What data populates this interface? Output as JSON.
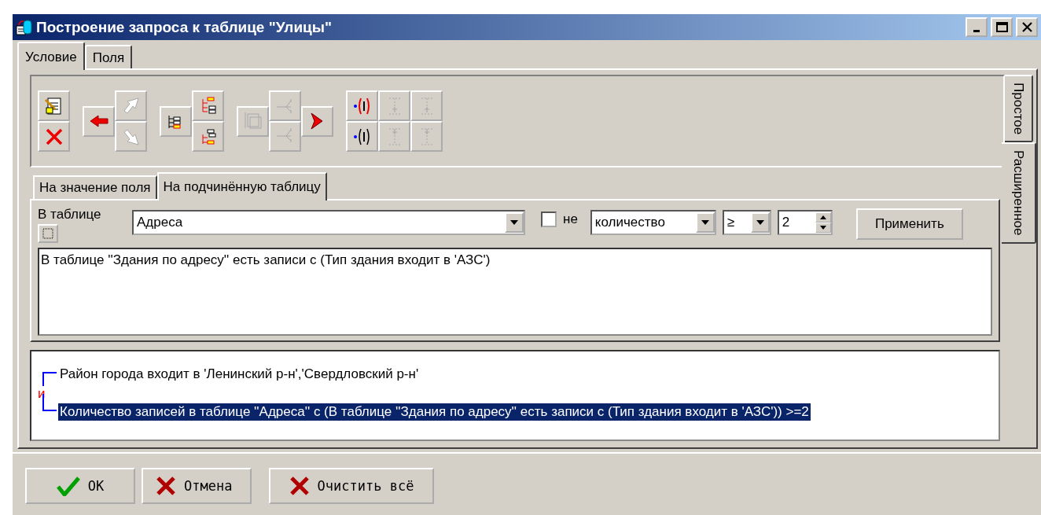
{
  "window": {
    "title": "Построение запроса к таблице \"Улицы\""
  },
  "tabs": [
    {
      "label": "Условие",
      "selected": true
    },
    {
      "label": "Поля",
      "selected": false
    }
  ],
  "side_tabs": [
    {
      "label": "Простое",
      "selected": false
    },
    {
      "label": "Расширенное",
      "selected": true
    }
  ],
  "toolbar": [
    [
      [
        {
          "disabled": false
        },
        {
          "disabled": false
        }
      ]
    ],
    [
      [
        {
          "disabled": false
        }
      ],
      [
        {
          "disabled": true
        },
        {
          "disabled": true
        }
      ]
    ],
    [
      [
        {
          "disabled": false
        }
      ],
      [
        {
          "disabled": false
        },
        {
          "disabled": false
        }
      ]
    ],
    [
      [
        {
          "disabled": true
        }
      ],
      [
        {
          "disabled": true
        },
        {
          "disabled": true
        }
      ],
      [
        {
          "disabled": false
        }
      ]
    ],
    [
      [
        {
          "disabled": false
        },
        {
          "disabled": false
        }
      ],
      [
        {
          "disabled": true
        },
        {
          "disabled": true
        }
      ],
      [
        {
          "disabled": true
        },
        {
          "disabled": true
        }
      ]
    ]
  ],
  "condition_tabs": [
    {
      "label": "На значение поля",
      "selected": false
    },
    {
      "label": "На подчинённую таблицу",
      "selected": true
    }
  ],
  "subtable": {
    "label": "В таблице",
    "table": "Адреса",
    "negate": {
      "label": "не",
      "checked": false
    },
    "aggregate": "количество",
    "operator": "≥",
    "count": "2",
    "apply": "Применить",
    "condition": "В таблице ''Здания по адресу'' есть записи с (Тип здания входит в 'АЗС')"
  },
  "conditions": {
    "items": [
      {
        "text": "Район города входит в 'Ленинский р-н','Свердловский р-н'",
        "selected": false
      },
      {
        "text": "Количество записей в таблице ''Адреса'' с (В таблице ''Здания по адресу'' есть записи с (Тип здания входит в 'АЗС')) >=2",
        "selected": true
      }
    ],
    "operator": "и"
  },
  "buttons": [
    {
      "label": "OK",
      "kind": "ok"
    },
    {
      "label": "Отмена",
      "kind": "cancel"
    },
    {
      "label": "Очистить всё",
      "kind": "clear"
    }
  ]
}
